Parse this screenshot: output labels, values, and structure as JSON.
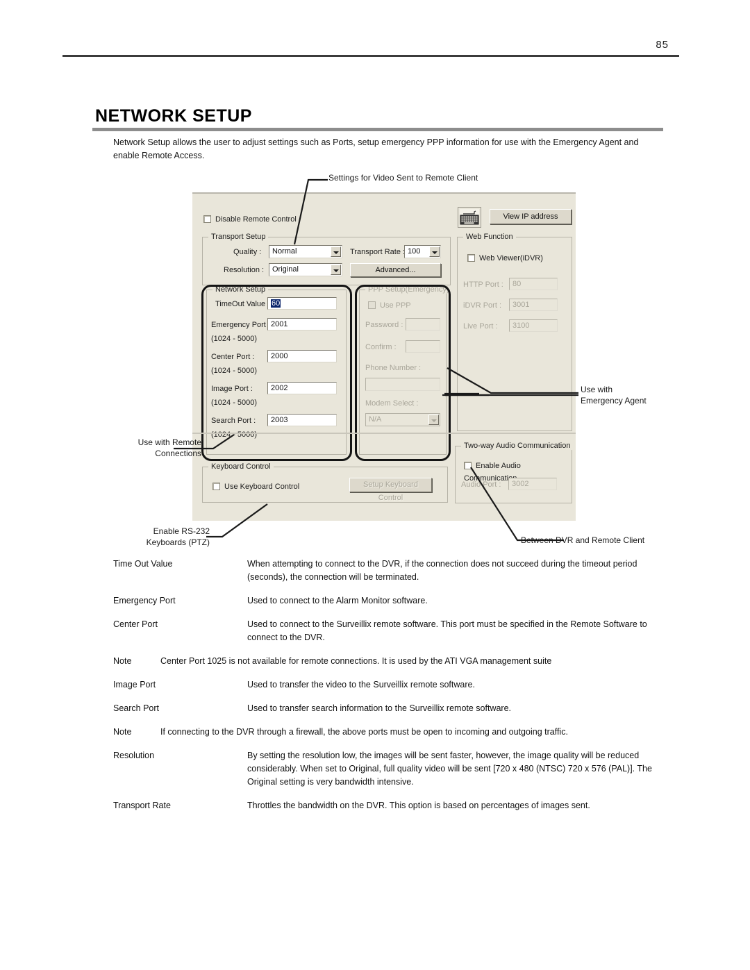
{
  "page": {
    "number": "85",
    "title": "NETWORK SETUP",
    "intro": "Network Setup allows the user to adjust settings such as Ports, setup emergency PPP information for use with the Emergency Agent and enable Remote Access."
  },
  "callouts": {
    "top": "Settings for Video Sent to Remote Client",
    "right": "Use with\nEmergency Agent",
    "left": "Use with Remote\nConnections",
    "keyboard": "Enable RS-232\nKeyboards (PTZ)",
    "audio": "Between DVR and Remote Client"
  },
  "dialog": {
    "disable_remote_control": "Disable Remote Control",
    "view_ip_button": "View  IP address",
    "keyboard_icon": "keyboard-icon",
    "transport_setup": {
      "title": "Transport Setup",
      "quality_label": "Quality :",
      "quality_value": "Normal",
      "resolution_label": "Resolution :",
      "resolution_value": "Original",
      "transport_rate_label": "Transport Rate :",
      "transport_rate_value": "100",
      "advanced_button": "Advanced..."
    },
    "network_setup": {
      "title": "Network Setup",
      "timeout_label": "TimeOut Value :",
      "timeout_value": "60",
      "emergency_port_label": "Emergency Port :",
      "emergency_port_value": "2001",
      "emergency_port_range": "(1024 - 5000)",
      "center_port_label": "Center Port :",
      "center_port_value": "2000",
      "center_port_range": "(1024 - 5000)",
      "image_port_label": "Image Port :",
      "image_port_value": "2002",
      "image_port_range": "(1024 - 5000)",
      "search_port_label": "Search Port :",
      "search_port_value": "2003",
      "search_port_range": "(1024 - 5000)"
    },
    "ppp_setup": {
      "title": "PPP Setup(Emergency)",
      "use_ppp": "Use PPP",
      "password_label": "Password :",
      "password_value": "",
      "confirm_label": "Confirm :",
      "confirm_value": "",
      "phone_label": "Phone Number :",
      "phone_value": "",
      "modem_label": "Modem Select :",
      "modem_value": "N/A"
    },
    "web_function": {
      "title": "Web Function",
      "web_viewer": "Web Viewer(iDVR)",
      "http_port_label": "HTTP Port :",
      "http_port_value": "80",
      "idvr_port_label": "iDVR Port :",
      "idvr_port_value": "3001",
      "live_port_label": "Live Port :",
      "live_port_value": "3100"
    },
    "keyboard_control": {
      "title": "Keyboard Control",
      "use_keyboard": "Use Keyboard Control",
      "setup_button": "Setup Keyboard Control"
    },
    "two_way_audio": {
      "title": "Two-way Audio Communication",
      "enable_audio": "Enable Audio Communication",
      "audio_port_label": "Audio Port :",
      "audio_port_value": "3002"
    }
  },
  "definitions": [
    {
      "term": "Time Out Value",
      "desc": "When attempting to connect to the DVR, if the connection does not succeed during the timeout period (seconds), the connection will be terminated."
    },
    {
      "term": "Emergency Port",
      "desc": "Used to connect to the Alarm Monitor software."
    },
    {
      "term": "Center Port",
      "desc": "Used to connect to the Surveillix remote software. This port must be specified in the Remote Software to connect to the DVR."
    },
    {
      "term": "Note",
      "desc": "Center Port 1025 is not available for remote connections. It is used by the ATI VGA management suite",
      "note": true
    },
    {
      "term": "Image Port",
      "desc": "Used to transfer the video to the Surveillix remote software."
    },
    {
      "term": "Search Port",
      "desc": "Used to transfer search information to the Surveillix remote software."
    },
    {
      "term": "Note",
      "desc": "If connecting to the DVR through a firewall, the above ports must be open to incoming and outgoing traffic.",
      "note": true
    },
    {
      "term": "Resolution",
      "desc": "By setting the resolution low, the images will be sent faster, however, the image quality will be reduced considerably. When set to Original, full quality video will be sent [720 x 480 (NTSC) 720 x 576 (PAL)]. The Original setting is very bandwidth intensive."
    },
    {
      "term": "Transport Rate",
      "desc": "Throttles the bandwidth on the DVR. This option is based on percentages of images sent."
    }
  ],
  "colors": {
    "dialog_bg": "#e9e6da",
    "rule": "#3b3b3b",
    "title_rule": "#8d8d8d",
    "selection": "#0a246a"
  }
}
